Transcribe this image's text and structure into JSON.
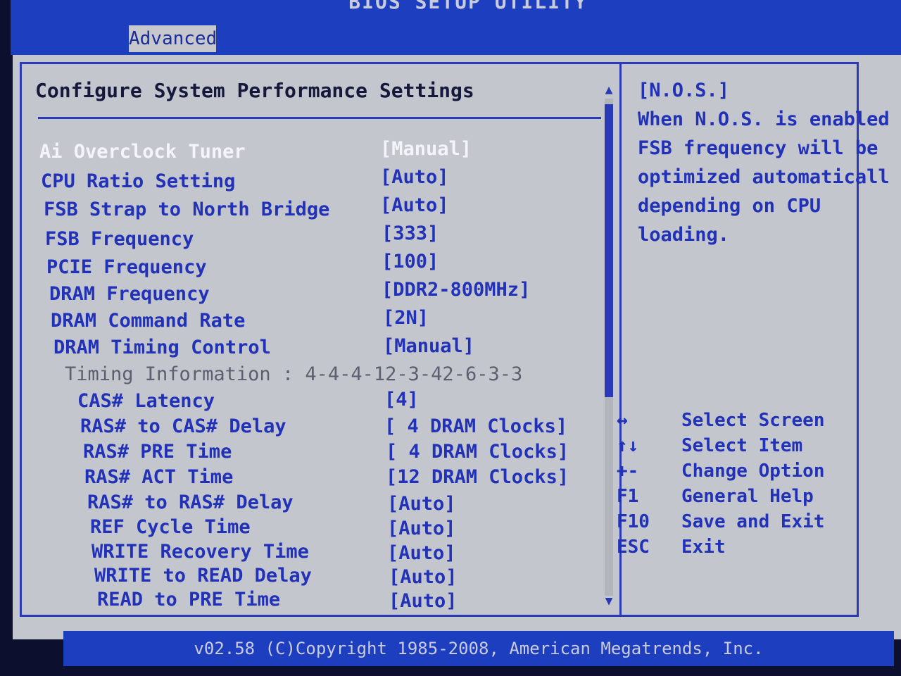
{
  "window": {
    "title": "BIOS SETUP UTILITY"
  },
  "tabs": [
    {
      "label": "Advanced",
      "active": true
    }
  ],
  "main": {
    "heading": "Configure System Performance Settings",
    "settings": [
      {
        "label": "Ai Overclock Tuner",
        "value": "[Manual]",
        "selected": true
      },
      {
        "label": "CPU Ratio Setting",
        "value": "[Auto]"
      },
      {
        "label": "FSB Strap to North Bridge",
        "value": "[Auto]"
      },
      {
        "label": "FSB Frequency",
        "value": "[333]"
      },
      {
        "label": "PCIE Frequency",
        "value": "[100]"
      },
      {
        "label": "DRAM Frequency",
        "value": "[DDR2-800MHz]"
      },
      {
        "label": "DRAM Command Rate",
        "value": "[2N]"
      },
      {
        "label": "DRAM Timing Control",
        "value": "[Manual]"
      },
      {
        "label": "Timing Information : 4-4-4-12-3-42-6-3-3",
        "value": "",
        "info": true
      },
      {
        "label": "CAS# Latency",
        "value": "[4]"
      },
      {
        "label": "RAS# to CAS# Delay",
        "value": "[ 4 DRAM Clocks]"
      },
      {
        "label": "RAS# PRE Time",
        "value": "[ 4 DRAM Clocks]"
      },
      {
        "label": "RAS# ACT Time",
        "value": "[12 DRAM Clocks]"
      },
      {
        "label": "RAS# to RAS# Delay",
        "value": "[Auto]"
      },
      {
        "label": "REF Cycle Time",
        "value": "[Auto]"
      },
      {
        "label": "WRITE Recovery Time",
        "value": "[Auto]"
      },
      {
        "label": "WRITE to READ Delay",
        "value": "[Auto]"
      },
      {
        "label": "READ to PRE Time",
        "value": "[Auto]"
      }
    ]
  },
  "help": {
    "title": "[N.O.S.]",
    "lines": [
      "When N.O.S. is enabled",
      "FSB frequency will be",
      "optimized automaticall",
      "depending on CPU",
      "loading."
    ]
  },
  "keys": [
    {
      "key": "↔",
      "desc": "Select Screen"
    },
    {
      "key": "↑↓",
      "desc": "Select Item"
    },
    {
      "key": "+-",
      "desc": "Change Option"
    },
    {
      "key": "F1",
      "desc": "General Help"
    },
    {
      "key": "F10",
      "desc": "Save and Exit"
    },
    {
      "key": "ESC",
      "desc": "Exit"
    }
  ],
  "footer": {
    "text": "v02.58 (C)Copyright 1985-2008, American Megatrends, Inc."
  }
}
